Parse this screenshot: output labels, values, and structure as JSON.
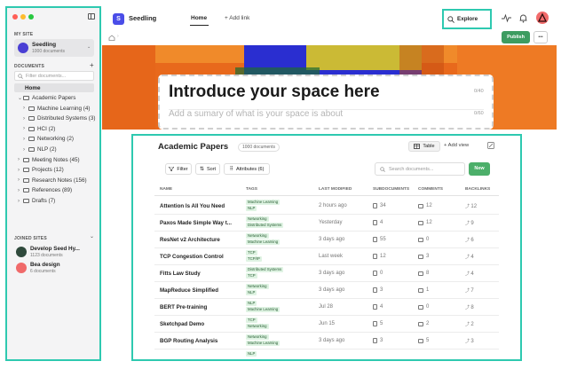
{
  "sidebar": {
    "my_site_label": "MY SITE",
    "site": {
      "name": "Seedling",
      "meta": "1000 documents"
    },
    "documents_label": "DOCUMENTS",
    "filter_placeholder": "Filter documents...",
    "home": "Home",
    "tree": [
      {
        "label": "Academic Papers",
        "depth": 0,
        "open": true
      },
      {
        "label": "Machine Learning (4)",
        "depth": 1
      },
      {
        "label": "Distributed Systems (3)",
        "depth": 1
      },
      {
        "label": "HCI (2)",
        "depth": 1
      },
      {
        "label": "Networking (2)",
        "depth": 1
      },
      {
        "label": "NLP (2)",
        "depth": 1
      },
      {
        "label": "Meeting Notes (45)",
        "depth": 0
      },
      {
        "label": "Projects (12)",
        "depth": 0
      },
      {
        "label": "Research Notes (156)",
        "depth": 0
      },
      {
        "label": "References (89)",
        "depth": 0
      },
      {
        "label": "Drafts (7)",
        "depth": 0
      }
    ],
    "joined_label": "JOINED SITES",
    "joined": [
      {
        "name": "Develop Seed Hy...",
        "meta": "1123 documents",
        "color": "#2f4a3c"
      },
      {
        "name": "Bea design",
        "meta": "6 documents",
        "color": "#f06a6a"
      }
    ]
  },
  "topbar": {
    "logo_letter": "S",
    "app_name": "Seedling",
    "home_tab": "Home",
    "add_link": "+ Add link",
    "explore": "Explore",
    "publish": "Publish",
    "more": "•••"
  },
  "hero": {
    "title": "Introduce your space here",
    "title_count": "0/40",
    "summary": "Add a sumary of what is your space is about",
    "summary_count": "0/60"
  },
  "collection": {
    "title": "Academic Papers",
    "count_badge": "1000 documents",
    "view_table": "Table",
    "add_view": "+ Add view",
    "filter": "Filter",
    "sort": "Sort",
    "attributes": "Attributes (6)",
    "search_placeholder": "Search documents...",
    "new_button": "New",
    "columns": [
      "NAME",
      "TAGS",
      "LAST MODIFIED",
      "SUBDOCUMENTS",
      "COMMENTS",
      "BACKLINKS"
    ],
    "rows": [
      {
        "name": "Attention Is All You Need",
        "tags": [
          "Machine Learning",
          "NLP"
        ],
        "modified": "2 hours ago",
        "subdocs": "34",
        "comments": "12",
        "backlinks": "12"
      },
      {
        "name": "Paxos Made Simple Way t...",
        "tags": [
          "Networking",
          "Distributed Systems"
        ],
        "modified": "Yesterday",
        "subdocs": "4",
        "comments": "12",
        "backlinks": "9"
      },
      {
        "name": "ResNet v2 Architecture",
        "tags": [
          "Networking",
          "Machine Learning"
        ],
        "modified": "3 days ago",
        "subdocs": "55",
        "comments": "0",
        "backlinks": "6"
      },
      {
        "name": "TCP Congestion Control",
        "tags": [
          "TCP",
          "TCP/IP"
        ],
        "modified": "Last week",
        "subdocs": "12",
        "comments": "3",
        "backlinks": "4"
      },
      {
        "name": "Fitts Law Study",
        "tags": [
          "Distributed Systems",
          "TCP"
        ],
        "modified": "3 days ago",
        "subdocs": "0",
        "comments": "8",
        "backlinks": "4"
      },
      {
        "name": "MapReduce Simplified",
        "tags": [
          "Networking",
          "NLP"
        ],
        "modified": "3 days ago",
        "subdocs": "3",
        "comments": "1",
        "backlinks": "7"
      },
      {
        "name": "BERT Pre-training",
        "tags": [
          "NLP",
          "Machine Learning"
        ],
        "modified": "Jul 28",
        "subdocs": "4",
        "comments": "0",
        "backlinks": "8"
      },
      {
        "name": "Sketchpad Demo",
        "tags": [
          "TCP",
          "Networking"
        ],
        "modified": "Jun 15",
        "subdocs": "5",
        "comments": "2",
        "backlinks": "2"
      },
      {
        "name": "BGP Routing Analysis",
        "tags": [
          "Networking",
          "Machine Learning"
        ],
        "modified": "3 days ago",
        "subdocs": "3",
        "comments": "5",
        "backlinks": "3"
      },
      {
        "name": "",
        "tags": [
          "NLP"
        ],
        "modified": "",
        "subdocs": "",
        "comments": "",
        "backlinks": ""
      }
    ]
  },
  "colors": {
    "accent": "#4a4de8",
    "teal": "#2ec9b0",
    "publish": "#3d9c61",
    "new": "#4caf6a",
    "banner": "#e8691c"
  }
}
